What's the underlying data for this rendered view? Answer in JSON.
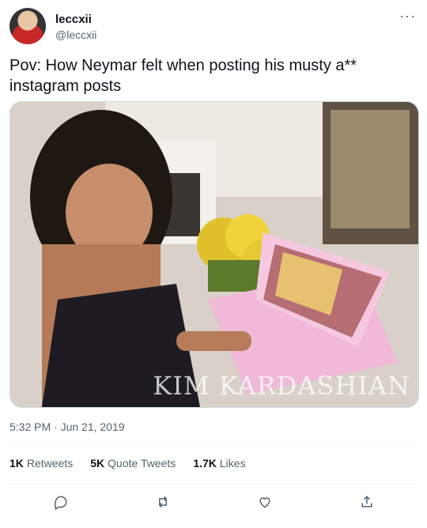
{
  "user": {
    "name": "leccxii",
    "handle": "@leccxii"
  },
  "tweet": {
    "text": "Pov: How Neymar felt when posting his musty a** instagram posts",
    "watermark": "KIM KARDASHIAN",
    "timestamp": "5:32 PM · Jun 21, 2019"
  },
  "stats": {
    "retweets": {
      "count": "1K",
      "label": "Retweets"
    },
    "quotes": {
      "count": "5K",
      "label": "Quote Tweets"
    },
    "likes": {
      "count": "1.7K",
      "label": "Likes"
    }
  },
  "icons": {
    "more": "more-icon",
    "reply": "reply-icon",
    "retweet": "retweet-icon",
    "like": "like-icon",
    "share": "share-icon"
  },
  "colors": {
    "text": "#0f1419",
    "secondary": "#536471",
    "border": "#cfd9de"
  }
}
